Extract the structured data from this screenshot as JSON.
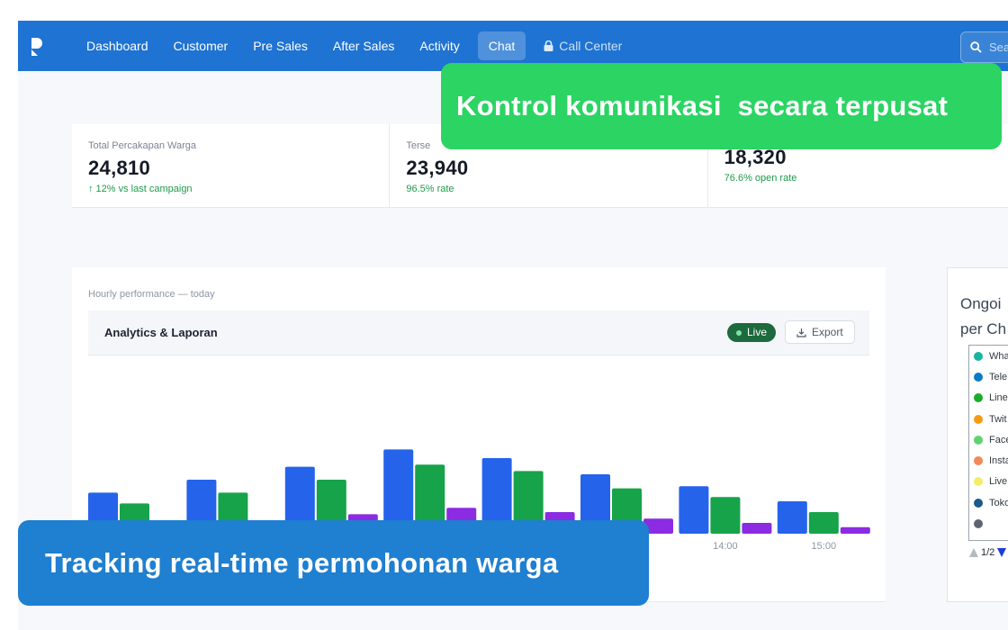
{
  "navbar": {
    "items": [
      {
        "label": "Dashboard",
        "active": false
      },
      {
        "label": "Customer",
        "active": false
      },
      {
        "label": "Pre Sales",
        "active": false
      },
      {
        "label": "After Sales",
        "active": false
      },
      {
        "label": "Activity",
        "active": false
      },
      {
        "label": "Chat",
        "active": true
      }
    ],
    "locked_item": "Call Center",
    "search_placeholder": "Search"
  },
  "stats": [
    {
      "label": "Total Percakapan Warga",
      "value": "24,810",
      "delta": "↑ 12% vs last campaign"
    },
    {
      "label": "Terse",
      "value": "23,940",
      "delta": "96.5% rate"
    },
    {
      "label": "",
      "value": "18,320",
      "delta": "76.6% open rate"
    }
  ],
  "chart_card": {
    "subtitle": "Hourly performance — today",
    "title": "Analytics & Laporan",
    "live_label": "Live",
    "export_label": "Export"
  },
  "chart_data": {
    "type": "bar",
    "categories": [
      "",
      "",
      "",
      "",
      "",
      "",
      "14:00",
      "15:00"
    ],
    "series": [
      {
        "values": [
          38,
          50,
          62,
          78,
          70,
          55,
          44,
          30
        ],
        "color": "#2563eb"
      },
      {
        "values": [
          28,
          38,
          50,
          64,
          58,
          42,
          34,
          20
        ],
        "color": "#16a34a"
      },
      {
        "values": [
          0,
          0,
          18,
          24,
          20,
          14,
          10,
          6
        ],
        "color": "#8b2be2"
      }
    ],
    "ylim": [
      0,
      100
    ]
  },
  "side_card": {
    "title_line1": "Ongoi",
    "title_line2": "per Ch",
    "legend": [
      {
        "label": "Wha",
        "color": "#19b5a0"
      },
      {
        "label": "Tele",
        "color": "#0a7bc4"
      },
      {
        "label": "Line",
        "color": "#1aab2a"
      },
      {
        "label": "Twit",
        "color": "#f59a13"
      },
      {
        "label": "Face",
        "color": "#5fd36f"
      },
      {
        "label": "Insta",
        "color": "#f3895a"
      },
      {
        "label": "Live",
        "color": "#f2ee6a"
      },
      {
        "label": "Toko",
        "color": "#1d5a8c"
      },
      {
        "label": "",
        "color": "#5f6570"
      }
    ],
    "pager": "1/2"
  },
  "callouts": {
    "green": "Kontrol komunikasi  secara terpusat",
    "blue": "Tracking real-time permohonan warga"
  }
}
